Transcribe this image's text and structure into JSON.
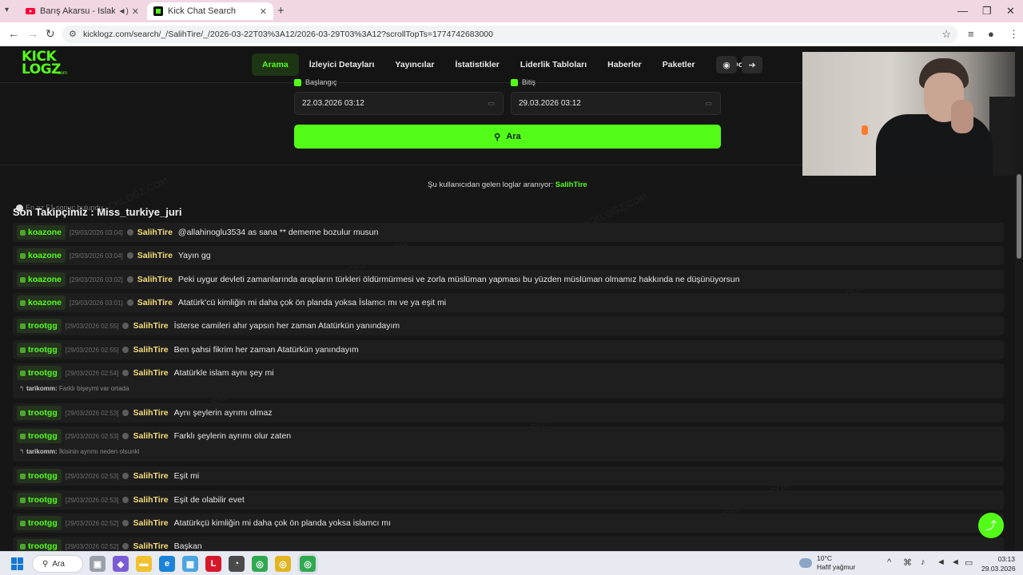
{
  "browser": {
    "tabs": [
      {
        "title": "Barış Akarsu - Islak Islak - Y",
        "active": false
      },
      {
        "title": "Kick Chat Search",
        "active": true
      }
    ],
    "url": "kicklogz.com/search/_/SalihTire/_/2026-03-22T03%3A12/2026-03-29T03%3A12?scrollTopTs=1774742683000"
  },
  "site": {
    "logo_line1": "KICK",
    "logo_line2": "LOGZ",
    "logo_suffix": ".com",
    "nav": [
      "Arama",
      "İzleyici Detayları",
      "Yayıncılar",
      "İstatistikler",
      "Liderlik Tabloları",
      "Haberler",
      "Paketler",
      "API Docs"
    ],
    "nav_active": "Arama",
    "form": {
      "start_label": "Başlangıç",
      "end_label": "Bitiş",
      "start_value": "22.03.2026 03:12",
      "end_value": "29.03.2026 03:12",
      "search_button": "Ara"
    },
    "searching_prefix": "Şu kullanıcıdan gelen loglar aranıyor:",
    "searching_user": "SalihTire",
    "results_count": "En az 51 sonuç bulundu",
    "follow_banner": "Son Takipçimiz : Miss_turkiye_juri",
    "messages": [
      {
        "channel": "koazone",
        "time": "[29/03/2026 03:04]",
        "user": "SalihTire",
        "text": "@allahinoglu3534 as sana ** dememe bozulur musun"
      },
      {
        "channel": "koazone",
        "time": "[29/03/2026 03:04]",
        "user": "SalihTire",
        "text": "Yayın gg"
      },
      {
        "channel": "koazone",
        "time": "[29/03/2026 03:02]",
        "user": "SalihTire",
        "text": "Peki uygur devleti zamanlarında arapların türkleri öldürmürmesi ve zorla müslüman yapması bu yüzden müslüman olmamız hakkında ne düşünüyorsun"
      },
      {
        "channel": "koazone",
        "time": "[29/03/2026 03:01]",
        "user": "SalihTire",
        "text": "Atatürk'cü kimliğin mi daha çok ön planda yoksa İslamcı mı ve ya eşit mi"
      },
      {
        "channel": "trootgg",
        "time": "[29/03/2026 02:55]",
        "user": "SalihTire",
        "text": "İsterse camileri ahır yapsın her zaman Atatürkün yanındayım"
      },
      {
        "channel": "trootgg",
        "time": "[29/03/2026 02:55]",
        "user": "SalihTire",
        "text": "Ben şahsi fikrim her zaman Atatürkün yanındayım"
      },
      {
        "channel": "trootgg",
        "time": "[29/03/2026 02:54]",
        "user": "SalihTire",
        "text": "Atatürkle islam aynı şey mi",
        "reply_user": "tarikomm:",
        "reply_text": "Farklı bişeymi var ortada"
      },
      {
        "channel": "trootgg",
        "time": "[29/03/2026 02:53]",
        "user": "SalihTire",
        "text": "Aynı şeylerin ayrımı olmaz"
      },
      {
        "channel": "trootgg",
        "time": "[29/03/2026 02:53]",
        "user": "SalihTire",
        "text": "Farklı şeylerin ayrımı olur zaten",
        "reply_user": "tarikomm:",
        "reply_text": "İkisinin ayrımı neden olsunki"
      },
      {
        "channel": "trootgg",
        "time": "[29/03/2026 02:53]",
        "user": "SalihTire",
        "text": "Eşit mi"
      },
      {
        "channel": "trootgg",
        "time": "[29/03/2026 02:53]",
        "user": "SalihTire",
        "text": "Eşit de olabilir evet"
      },
      {
        "channel": "trootgg",
        "time": "[29/03/2026 02:52]",
        "user": "SalihTire",
        "text": "Atatürkçü kimliğin mi daha çok ön planda yoksa islamcı mı"
      },
      {
        "channel": "trootgg",
        "time": "[29/03/2026 02:52]",
        "user": "SalihTire",
        "text": "Başkan"
      }
    ]
  },
  "taskbar": {
    "search": "Ara",
    "weather_temp": "10°C",
    "weather_desc": "Hafif yağmur",
    "time": "03:13",
    "date": "29.03.2026"
  },
  "colors": {
    "accent": "#53fc18",
    "username": "#f6dd7a",
    "background": "#161616"
  },
  "icons": [
    "youtube-icon",
    "kicklogz-icon",
    "discord-icon",
    "login-icon",
    "search-icon",
    "calendar-icon",
    "share-icon",
    "windows-icon"
  ]
}
